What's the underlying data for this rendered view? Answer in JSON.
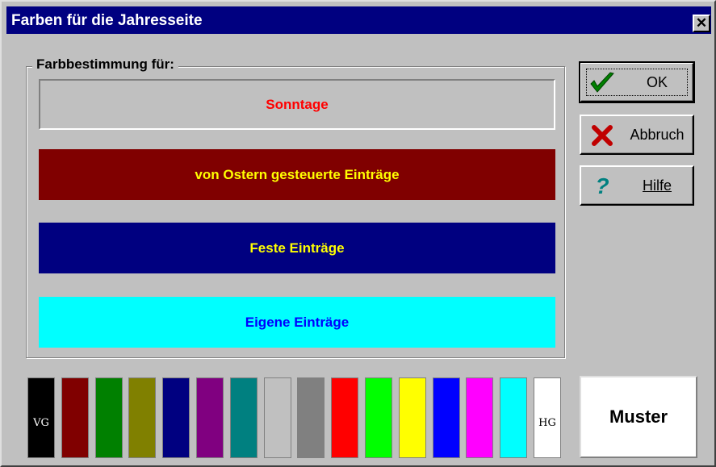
{
  "dialog": {
    "title": "Farben für die Jahresseite"
  },
  "group": {
    "label": "Farbbestimmung für:",
    "items": [
      {
        "label": "Sonntage",
        "bg": "#c0c0c0",
        "fg": "#ff0000"
      },
      {
        "label": "von Ostern gesteuerte Einträge",
        "bg": "#800000",
        "fg": "#ffff00"
      },
      {
        "label": "Feste Einträge",
        "bg": "#000080",
        "fg": "#ffff00"
      },
      {
        "label": "Eigene Einträge",
        "bg": "#00ffff",
        "fg": "#0000ff"
      }
    ]
  },
  "buttons": {
    "ok": {
      "label": "OK",
      "icon": "checkmark-icon"
    },
    "abbruch": {
      "label": "Abbruch",
      "icon": "x-icon"
    },
    "hilfe": {
      "label": "Hilfe",
      "icon": "question-icon"
    }
  },
  "palette": {
    "colors": [
      "#000000",
      "#800000",
      "#008000",
      "#808000",
      "#000080",
      "#800080",
      "#008080",
      "#c0c0c0",
      "#808080",
      "#ff0000",
      "#00ff00",
      "#ffff00",
      "#0000ff",
      "#ff00ff",
      "#00ffff",
      "#ffffff"
    ],
    "fg_marker": "VG",
    "bg_marker": "HG"
  },
  "preview": {
    "label": "Muster"
  }
}
